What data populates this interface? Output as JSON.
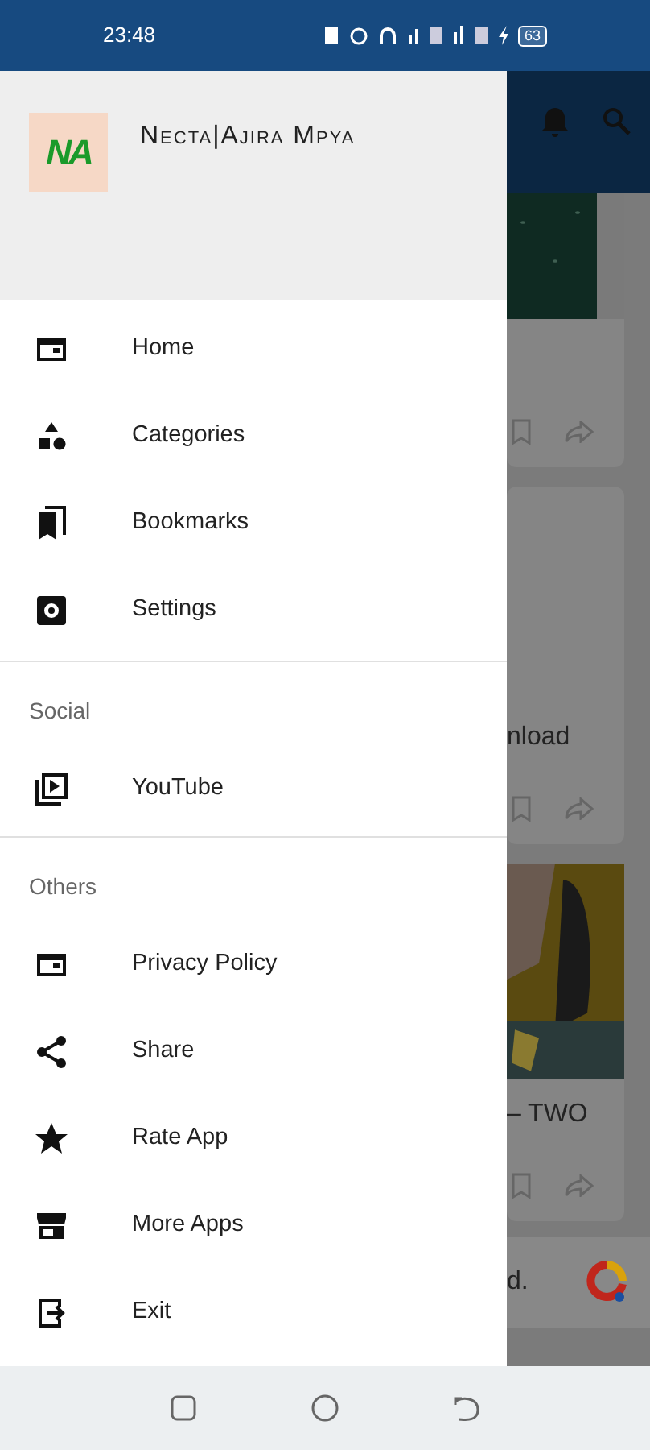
{
  "status_bar": {
    "time": "23:48",
    "battery": "63"
  },
  "drawer": {
    "logo": "NA",
    "title": "Necta|Ajira Mpya",
    "sections": [
      {
        "items": [
          {
            "label": "Home"
          },
          {
            "label": "Categories"
          },
          {
            "label": "Bookmarks"
          },
          {
            "label": "Settings"
          }
        ]
      },
      {
        "title": "Social",
        "items": [
          {
            "label": "YouTube"
          }
        ]
      },
      {
        "title": "Others",
        "items": [
          {
            "label": "Privacy Policy"
          },
          {
            "label": "Share"
          },
          {
            "label": "Rate App"
          },
          {
            "label": "More Apps"
          },
          {
            "label": "Exit"
          }
        ]
      }
    ]
  },
  "background": {
    "cards": [
      {
        "kind": "picture"
      },
      {
        "kind": "text",
        "title": "nload"
      },
      {
        "kind": "picture",
        "title": "– TWO"
      }
    ],
    "ad_text": "d."
  }
}
